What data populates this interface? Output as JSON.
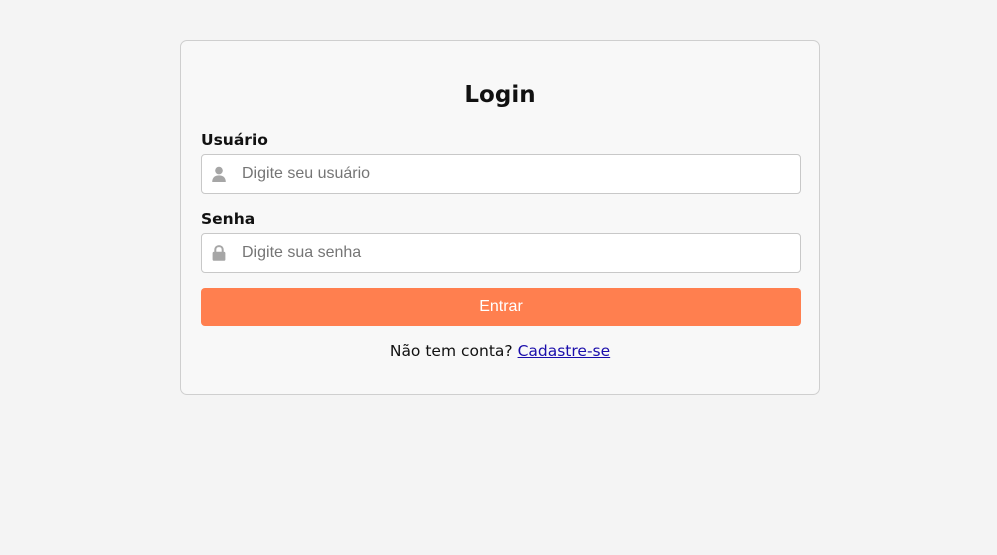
{
  "login": {
    "title": "Login",
    "username": {
      "label": "Usuário",
      "placeholder": "Digite seu usuário",
      "value": "",
      "icon": "user-icon"
    },
    "password": {
      "label": "Senha",
      "placeholder": "Digite sua senha",
      "value": "",
      "icon": "lock-icon"
    },
    "submit_label": "Entrar",
    "signup_prompt": "Não tem conta?",
    "signup_link": "Cadastre-se"
  },
  "colors": {
    "background": "#f4f4f4",
    "card": "#f8f8f8",
    "accent": "#ff7f4f",
    "link": "#1a0dab",
    "icon": "#a6a6a6"
  }
}
